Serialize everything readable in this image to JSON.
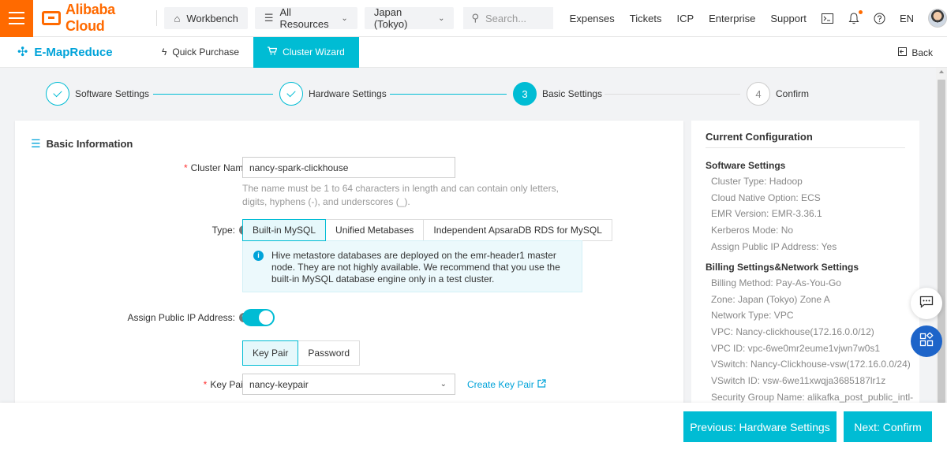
{
  "topbar": {
    "brand": "Alibaba Cloud",
    "workbench": "Workbench",
    "all_resources": "All Resources",
    "region": "Japan (Tokyo)",
    "search_placeholder": "Search...",
    "links": [
      "Expenses",
      "Tickets",
      "ICP",
      "Enterprise",
      "Support"
    ],
    "language": "EN",
    "accent_color": "#ff6a00"
  },
  "subbar": {
    "product": "E-MapReduce",
    "tabs": [
      "Quick Purchase",
      "Cluster Wizard"
    ],
    "active_tab": "Cluster Wizard",
    "back": "Back",
    "accent_color": "#00bcd4"
  },
  "steps": [
    {
      "number": "1",
      "label": "Software Settings",
      "state": "done"
    },
    {
      "number": "2",
      "label": "Hardware Settings",
      "state": "done"
    },
    {
      "number": "3",
      "label": "Basic Settings",
      "state": "active"
    },
    {
      "number": "4",
      "label": "Confirm",
      "state": "todo"
    }
  ],
  "basic_info": {
    "title": "Basic Information",
    "cluster_name_label": "Cluster Name",
    "cluster_name_value": "nancy-spark-clickhouse",
    "cluster_name_hint": "The name must be 1 to 64 characters in length and can contain only letters, digits, hyphens (-), and underscores (_).",
    "type_label": "Type:",
    "type_options": [
      "Built-in MySQL",
      "Unified Metabases",
      "Independent ApsaraDB RDS for MySQL"
    ],
    "type_selected": "Built-in MySQL",
    "type_info": "Hive metastore databases are deployed on the emr-header1 master node. They are not highly available. We recommend that you use the built-in MySQL database engine only in a test cluster.",
    "public_ip_label": "Assign Public IP Address:",
    "public_ip_enabled": true,
    "auth_options": [
      "Key Pair",
      "Password"
    ],
    "auth_selected": "Key Pair",
    "key_pair_label": "Key Pair:",
    "key_pair_value": "nancy-keypair",
    "create_key_pair": "Create Key Pair"
  },
  "current_config": {
    "title": "Current Configuration",
    "software_title": "Software Settings",
    "software_items": [
      "Cluster Type:  Hadoop",
      "Cloud Native Option:  ECS",
      "EMR Version:  EMR-3.36.1",
      "Kerberos Mode:  No",
      "Assign Public IP Address:  Yes"
    ],
    "billing_title": "Billing Settings&Network Settings",
    "billing_items": [
      "Billing Method:  Pay-As-You-Go",
      "Zone:  Japan (Tokyo) Zone A",
      "Network Type:  VPC",
      "VPC:  Nancy-clickhouse(172.16.0.0/12)",
      "VPC ID:  vpc-6we0mr2eume1vjwn7w0s1",
      "VSwitch:  Nancy-Clickhouse-vsw(172.16.0.0/24)",
      "VSwitch ID:  vsw-6we11xwqja3685187lr1z",
      "Security Group Name:  alikafka_post_public_intl-"
    ]
  },
  "footer": {
    "previous": "Previous: Hardware Settings",
    "next": "Next: Confirm"
  }
}
